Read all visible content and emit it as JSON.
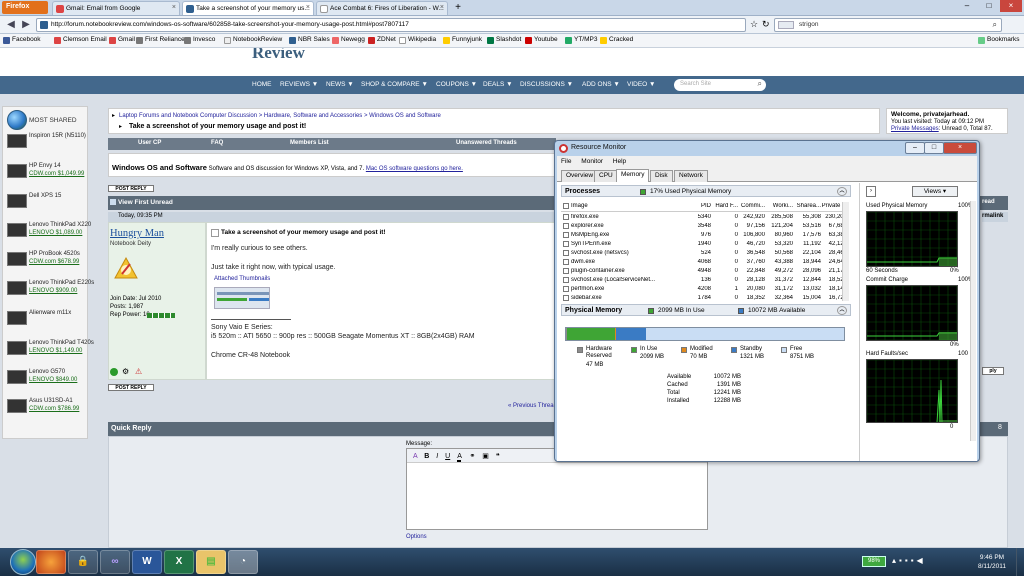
{
  "browser": {
    "menu_label": "Firefox",
    "tabs": [
      {
        "label": "Gmail: Email from Google",
        "active": false
      },
      {
        "label": "Take a screenshot of your memory us...",
        "active": true
      },
      {
        "label": "Ace Combat 6: Fires of Liberation - W...",
        "active": false
      }
    ],
    "url": "http://forum.notebookreview.com/windows-os-software/602858-take-screenshot-your-memory-usage-post.html#post7807117",
    "search_engine": "strigon",
    "bookmarks": [
      "Facebook",
      "Clemson Email",
      "Gmail",
      "First Reliance",
      "Invesco",
      "NotebookReview",
      "NBR Sales",
      "Newegg",
      "ZDNet",
      "Wikipedia",
      "Funnyjunk",
      "Slashdot",
      "Youtube",
      "YT/MP3",
      "Cracked"
    ],
    "bookmarks_menu": "Bookmarks"
  },
  "site": {
    "logo_small": "notebook",
    "logo": "Review",
    "nav": [
      "HOME",
      "REVIEWS ▼",
      "NEWS ▼",
      "SHOP & COMPARE ▼",
      "COUPONS ▼",
      "DEALS ▼",
      "ADD ONS ▼",
      "DISCUSSIONS ▼",
      "ADD ONS ▼",
      "VIDEO ▼"
    ],
    "search_placeholder": "Search Site"
  },
  "sidebar": {
    "title": "MOST SHARED",
    "items": [
      {
        "name": "Inspiron 15R (N5110)",
        "price": ""
      },
      {
        "name": "HP Envy 14",
        "price": "CDW.com $1,049.99"
      },
      {
        "name": "Dell XPS 15",
        "price": ""
      },
      {
        "name": "Lenovo ThinkPad X220",
        "price": "LENOVO $1,089.00"
      },
      {
        "name": "HP ProBook 4520s",
        "price": "CDW.com $678.99"
      },
      {
        "name": "Lenovo ThinkPad E220s",
        "price": "LENOVO $909.00"
      },
      {
        "name": "Alienware m11x",
        "price": ""
      },
      {
        "name": "Lenovo ThinkPad T420s",
        "price": "LENOVO $1,149.00"
      },
      {
        "name": "Lenovo G570",
        "price": "LENOVO $849.00"
      },
      {
        "name": "Asus U31SD-A1",
        "price": "CDW.com $786.99"
      }
    ]
  },
  "forum": {
    "breadcrumb": "Laptop Forums and Notebook Computer Discussion > Hardware, Software and Accessories > Windows OS and Software",
    "thread_title": "Take a screenshot of your memory usage and post it!",
    "welcome_title": "Welcome, privatejarhead.",
    "last_visited": "You last visited: Today at 09:12 PM",
    "pm_link": "Private Messages",
    "pm_status": ": Unread 0, Total 87.",
    "ucp_links": [
      "User CP",
      "FAQ",
      "Members List",
      "Unanswered Threads"
    ],
    "forum_name": "Windows OS and Software",
    "forum_desc": "Software and OS discussion for Windows XP, Vista, and 7.",
    "forum_link": "Mac OS software questions go here.",
    "post_reply": "POST REPLY",
    "view_first_unread": "View First Unread",
    "thread_tools": "read",
    "permalink": "rmalink",
    "post_date": "Today, 09:35 PM",
    "user": {
      "name": "Hungry Man",
      "title": "Notebook Deity",
      "join_date": "Join Date: Jul 2010",
      "posts": "Posts: 1,987",
      "rep_power": "Rep Power: 10"
    },
    "post_title": "Take a screenshot of your memory usage and post it!",
    "post_lines": [
      "I'm really curious to see others.",
      "Just take it right now, with typical usage."
    ],
    "attached_label": "Attached Thumbnails",
    "sig_line1": "Sony Vaio E Series:",
    "sig_line2": "i5 520m :: ATI 5650 :: 900p res :: 500GB Seagate Momentus XT :: 8GB(2x4GB) RAM",
    "sig_line3": "Chrome CR-48 Notebook",
    "prev_thread": "« Previous Thread",
    "quick_reply": "Quick Reply",
    "message_label": "Message:",
    "options_label": "Options"
  },
  "resource_monitor": {
    "title": "Resource Monitor",
    "menu": [
      "File",
      "Monitor",
      "Help"
    ],
    "tabs": [
      "Overview",
      "CPU",
      "Memory",
      "Disk",
      "Network"
    ],
    "active_tab": "Memory",
    "processes_label": "Processes",
    "processes_summary": "17% Used Physical Memory",
    "columns": [
      "Image",
      "PID",
      "Hard F...",
      "Commi...",
      "Worki...",
      "Sharea...",
      "Private ..."
    ],
    "processes": [
      [
        "firefox.exe",
        "5340",
        "0",
        "242,920",
        "285,508",
        "55,308",
        "230,200"
      ],
      [
        "explorer.exe",
        "3548",
        "0",
        "97,156",
        "121,204",
        "53,516",
        "67,688"
      ],
      [
        "MsMpEng.exe",
        "976",
        "0",
        "106,800",
        "80,960",
        "17,576",
        "63,384"
      ],
      [
        "SynTPEnh.exe",
        "1940",
        "0",
        "46,720",
        "53,320",
        "11,192",
        "42,128"
      ],
      [
        "svchost.exe (netsvcs)",
        "524",
        "0",
        "36,548",
        "50,568",
        "22,104",
        "28,464"
      ],
      [
        "dwm.exe",
        "4068",
        "0",
        "37,760",
        "43,388",
        "18,944",
        "24,644"
      ],
      [
        "plugin-container.exe",
        "4948",
        "0",
        "22,848",
        "49,272",
        "28,096",
        "21,176"
      ],
      [
        "svchost.exe (LocalServiceNet...",
        "136",
        "0",
        "28,128",
        "31,372",
        "12,844",
        "18,528"
      ],
      [
        "perfmon.exe",
        "4208",
        "1",
        "20,080",
        "31,172",
        "13,032",
        "18,140"
      ],
      [
        "sidebar.exe",
        "1784",
        "0",
        "18,352",
        "32,364",
        "15,004",
        "16,720"
      ]
    ],
    "physical_label": "Physical Memory",
    "in_use_summary": "2099 MB In Use",
    "available_summary": "10072 MB Available",
    "legend": [
      {
        "label": "Hardware Reserved",
        "value": "47 MB",
        "color": "#8c8c8c"
      },
      {
        "label": "In Use",
        "value": "2099 MB",
        "color": "#3fa535"
      },
      {
        "label": "Modified",
        "value": "70 MB",
        "color": "#e08a1e"
      },
      {
        "label": "Standby",
        "value": "1321 MB",
        "color": "#3a7bc4"
      },
      {
        "label": "Free",
        "value": "8751 MB",
        "color": "#c9ddf4"
      }
    ],
    "stats": [
      {
        "label": "Available",
        "value": "10072 MB"
      },
      {
        "label": "Cached",
        "value": "1391 MB"
      },
      {
        "label": "Total",
        "value": "12241 MB"
      },
      {
        "label": "Installed",
        "value": "12288 MB"
      }
    ],
    "views_label": "Views",
    "graphs": [
      {
        "title": "Used Physical Memory",
        "max": "100%",
        "bottom_left": "60 Seconds",
        "bottom_right": "0%"
      },
      {
        "title": "Commit Charge",
        "max": "100%",
        "bottom_left": "",
        "bottom_right": "0%"
      },
      {
        "title": "Hard Faults/sec",
        "max": "100",
        "bottom_left": "",
        "bottom_right": "0"
      }
    ]
  },
  "taskbar": {
    "apps": [
      "Firefox",
      "Keepass",
      "Visual Studio",
      "Word",
      "Excel",
      "Explorer",
      "Resource Monitor"
    ],
    "battery": "98%",
    "time": "9:46 PM",
    "date": "8/11/2011"
  }
}
